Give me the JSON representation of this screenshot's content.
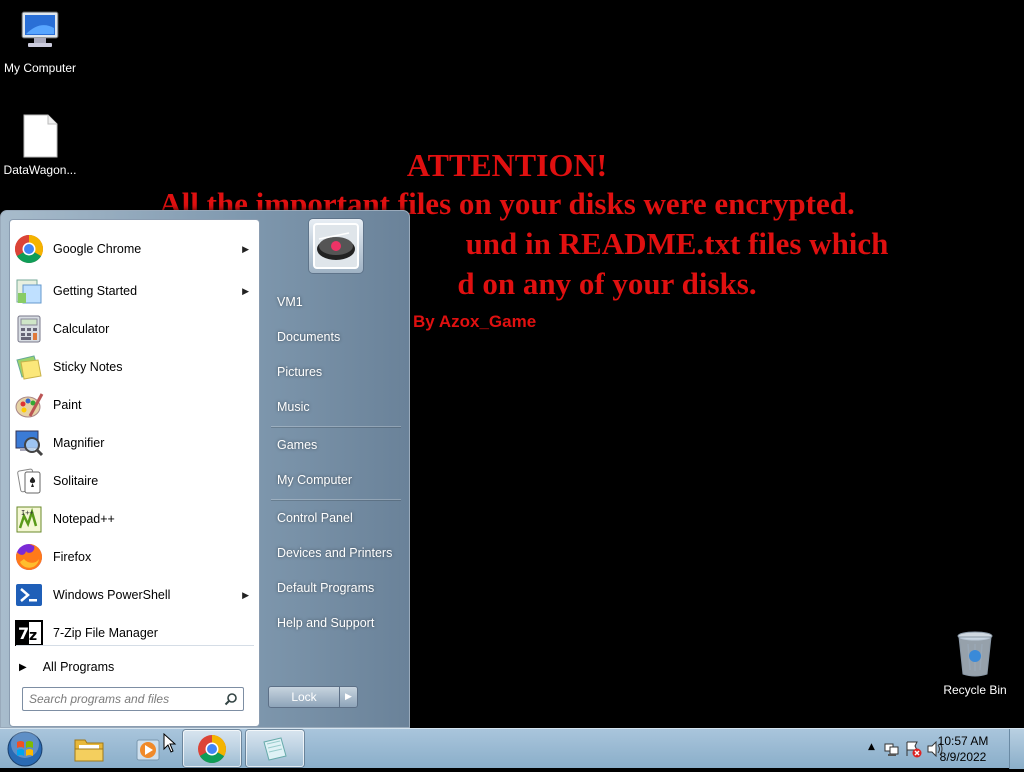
{
  "desktop": {
    "icons": {
      "my_computer": "My Computer",
      "datawagon": "DataWagon...",
      "recycle_bin": "Recycle Bin"
    },
    "ransom_note": {
      "line1": "ATTENTION!",
      "line2": "All the important files on your disks were encrypted.",
      "line3": "und in README.txt files which",
      "line4": "d on any of your disks.",
      "byline": "By Azox_Game",
      "color": "#e01010"
    }
  },
  "start_menu": {
    "programs": [
      {
        "label": "Google Chrome",
        "icon": "chrome-icon",
        "submenu": true
      },
      {
        "label": "Getting Started",
        "icon": "getting-started-icon",
        "submenu": true
      },
      {
        "label": "Calculator",
        "icon": "calculator-icon",
        "submenu": false
      },
      {
        "label": "Sticky Notes",
        "icon": "sticky-notes-icon",
        "submenu": false
      },
      {
        "label": "Paint",
        "icon": "paint-icon",
        "submenu": false
      },
      {
        "label": "Magnifier",
        "icon": "magnifier-icon",
        "submenu": false
      },
      {
        "label": "Solitaire",
        "icon": "solitaire-icon",
        "submenu": false
      },
      {
        "label": "Notepad++",
        "icon": "notepadpp-icon",
        "submenu": false
      },
      {
        "label": "Firefox",
        "icon": "firefox-icon",
        "submenu": false
      },
      {
        "label": "Windows PowerShell",
        "icon": "powershell-icon",
        "submenu": true
      },
      {
        "label": "7-Zip File Manager",
        "icon": "7zip-icon",
        "submenu": false
      }
    ],
    "all_programs": "All Programs",
    "search_placeholder": "Search programs and files",
    "right_items": [
      "VM1",
      "Documents",
      "Pictures",
      "Music",
      "Games",
      "My Computer",
      "Control Panel",
      "Devices and Printers",
      "Default Programs",
      "Help and Support"
    ],
    "lock_label": "Lock"
  },
  "taskbar": {
    "pinned": [
      "explorer-icon",
      "media-player-icon",
      "chrome-icon",
      "notepad-icon"
    ],
    "clock_time": "10:57 AM",
    "clock_date": "8/9/2022"
  }
}
